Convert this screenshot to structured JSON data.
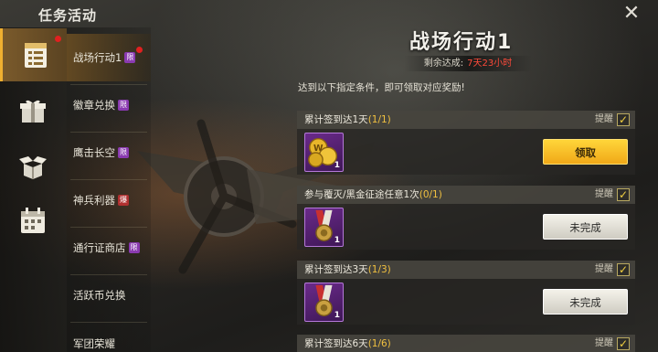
{
  "app": {
    "title": "任务活动",
    "close_icon": "close-icon"
  },
  "iconbar": [
    {
      "icon": "task-list-icon",
      "active": true,
      "badge": true
    },
    {
      "icon": "gift-box-icon",
      "active": false,
      "badge": false
    },
    {
      "icon": "open-box-icon",
      "active": false,
      "badge": false
    },
    {
      "icon": "calendar-icon",
      "active": false,
      "badge": false
    }
  ],
  "nav": {
    "items": [
      {
        "label": "战场行动1",
        "tag": "限",
        "active": true
      },
      {
        "label": "徽章兑换",
        "tag": "限",
        "active": false
      },
      {
        "label": "鹰击长空",
        "tag": "限",
        "active": false
      },
      {
        "label": "神兵利器",
        "tag": "爆",
        "active": false
      },
      {
        "label": "通行证商店",
        "tag": "限",
        "active": false
      },
      {
        "label": "活跃币兑换",
        "tag": "",
        "active": false
      },
      {
        "label": "军团荣耀",
        "tag": "",
        "active": false
      }
    ]
  },
  "main": {
    "title": "战场行动1",
    "remaining_label": "剩余达成:",
    "remaining_value": "7天23小时",
    "description": "达到以下指定条件，即可领取对应奖励!",
    "remind_label": "提醒",
    "tasks": [
      {
        "title": "累计签到达1天",
        "progress": "(1/1)",
        "reward_icon": "gold-coins-icon",
        "reward_qty": "1",
        "button": "领取",
        "button_state": "claim"
      },
      {
        "title": "参与覆灭/黑金征途任意1次",
        "progress": "(0/1)",
        "reward_icon": "medal-icon",
        "reward_qty": "1",
        "button": "未完成",
        "button_state": "todo"
      },
      {
        "title": "累计签到达3天",
        "progress": "(1/3)",
        "reward_icon": "medal-icon",
        "reward_qty": "1",
        "button": "未完成",
        "button_state": "todo"
      },
      {
        "title": "累计签到达6天",
        "progress": "(1/6)",
        "reward_icon": "",
        "reward_qty": "",
        "button": "",
        "button_state": ""
      }
    ]
  },
  "colors": {
    "accent": "#f0b030",
    "claim_button": "#ffd63a",
    "tag_limited": "#8a3ab0",
    "tag_hot": "#b03030",
    "countdown": "#ff4a3a"
  }
}
